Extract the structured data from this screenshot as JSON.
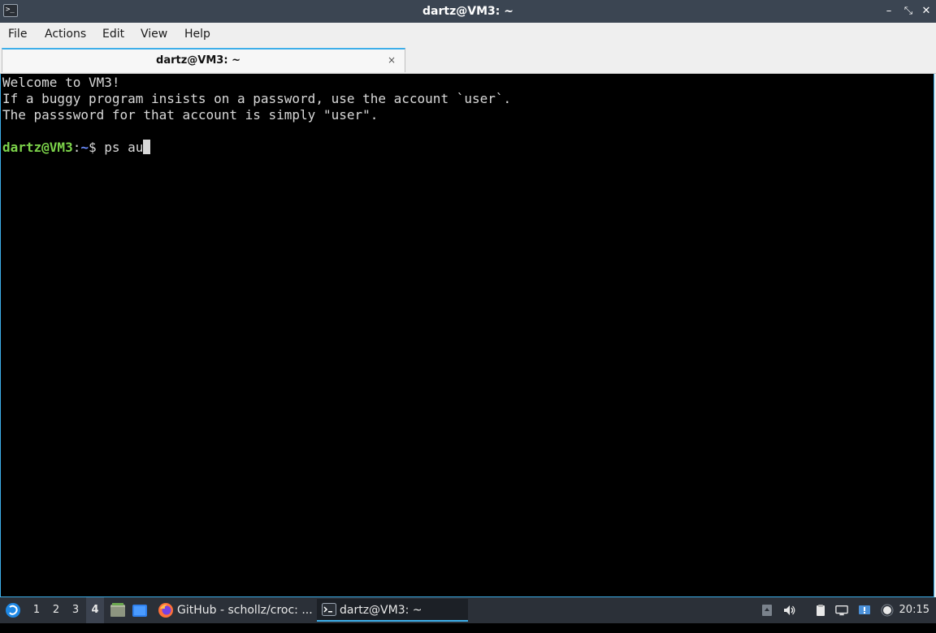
{
  "window": {
    "title": "dartz@VM3: ~",
    "app_icon_text": ">_"
  },
  "title_controls": {
    "minimize": "–",
    "maximize": "⤡",
    "close": "✕"
  },
  "menu": {
    "file": "File",
    "actions": "Actions",
    "edit": "Edit",
    "view": "View",
    "help": "Help"
  },
  "tabs": [
    {
      "label": "dartz@VM3: ~",
      "close": "×",
      "active": true
    }
  ],
  "terminal": {
    "lines": [
      "Welcome to VM3!",
      "If a buggy program insists on a password, use the account `user`.",
      "The passsword for that account is simply \"user\"."
    ],
    "prompt": {
      "user_host": "dartz@VM3",
      "separator": ":",
      "path": "~",
      "symbol": "$ ",
      "command": "ps au"
    }
  },
  "taskbar": {
    "desktops": [
      "1",
      "2",
      "3",
      "4"
    ],
    "active_desktop": "4",
    "tasks": [
      {
        "label": "GitHub - schollz/croc: ...",
        "icon": "firefox-icon"
      },
      {
        "label": "dartz@VM3: ~",
        "icon": "terminal-icon",
        "active": true
      }
    ],
    "clock": "20:15"
  },
  "colors": {
    "titlebar": "#3b4552",
    "accent": "#3daee9",
    "prompt_user": "#7cd34a",
    "prompt_path": "#6a8cff",
    "taskbar": "#2b3038"
  }
}
